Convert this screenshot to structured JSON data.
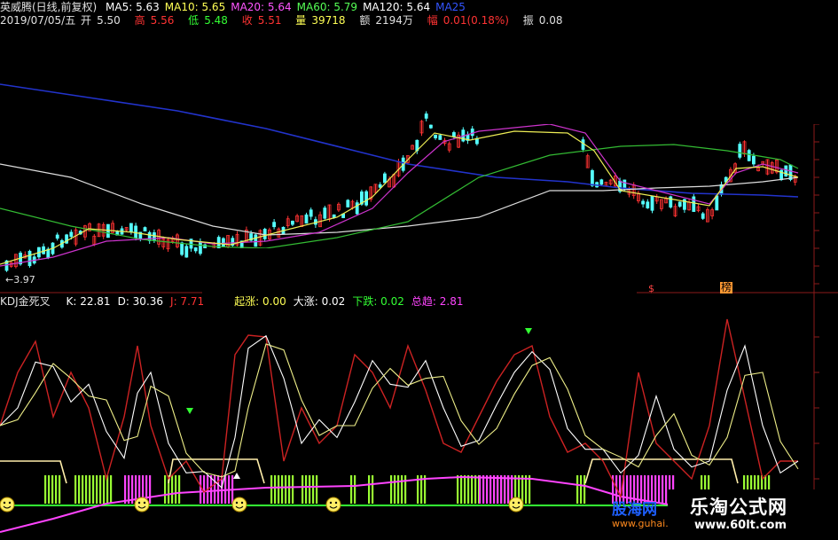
{
  "header": {
    "title": "英威腾(日线,前复权)",
    "ma": [
      {
        "label": "MA5: 5.63",
        "color": "#ffffff"
      },
      {
        "label": "MA10: 5.65",
        "color": "#ffff55"
      },
      {
        "label": "MA20: 5.64",
        "color": "#ff55ff"
      },
      {
        "label": "MA60: 5.79",
        "color": "#55ff55"
      },
      {
        "label": "MA120: 5.64",
        "color": "#ffffff"
      },
      {
        "label": "MA25",
        "color": "#3355ff"
      }
    ],
    "quote": {
      "date": "2019/07/05/五",
      "open_label": "开",
      "open": "5.50",
      "high_label": "高",
      "high": "5.56",
      "low_label": "低",
      "low": "5.48",
      "close_label": "收",
      "close": "5.51",
      "vol_label": "量",
      "vol": "39718",
      "amt_label": "额",
      "amt": "2194万",
      "chg_label": "幅",
      "chg": "0.01(0.18%)",
      "amp_label": "振",
      "amp": "0.08"
    }
  },
  "price_chart": {
    "low_marker": "←3.97",
    "tags": [
      "$",
      "榜"
    ]
  },
  "kdj": {
    "title": "KDJ金死叉",
    "values": [
      {
        "label": "K: 22.81",
        "color": "#ffffff"
      },
      {
        "label": "D: 30.36",
        "color": "#ffffff"
      },
      {
        "label": "J: 7.71",
        "color": "#ff3333"
      },
      {
        "label": "起涨: 0.00",
        "color": "#ffff55"
      },
      {
        "label": "大涨: 0.02",
        "color": "#ffffff"
      },
      {
        "label": "下跌: 0.02",
        "color": "#33ff33"
      },
      {
        "label": "总趋: 2.81",
        "color": "#ff44ff"
      }
    ]
  },
  "watermarks": {
    "site_title": "乐淘公式网",
    "site_url": "www.60lt.com",
    "site2": "股海网",
    "site2_url": "www.guhai.com"
  }
}
